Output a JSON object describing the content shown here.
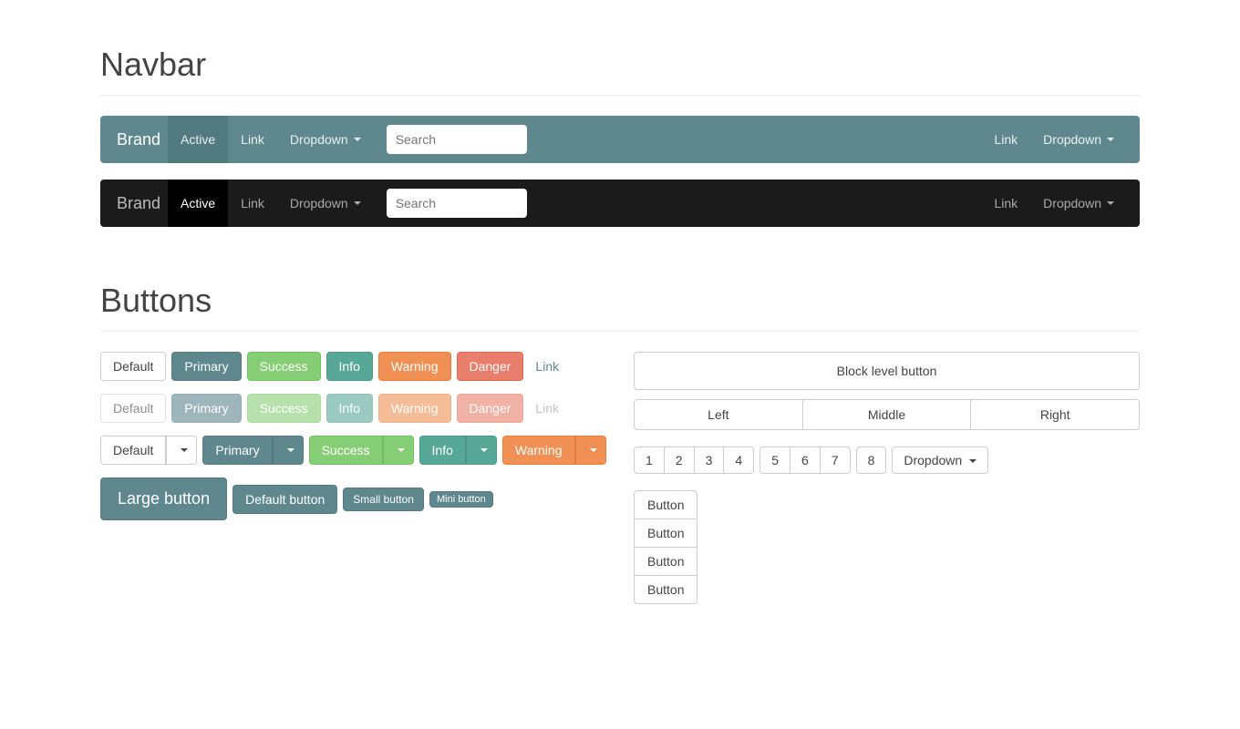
{
  "sections": {
    "navbar_heading": "Navbar",
    "buttons_heading": "Buttons"
  },
  "navbar": {
    "brand": "Brand",
    "items": [
      "Active",
      "Link",
      "Dropdown"
    ],
    "search_placeholder": "Search",
    "right_items": [
      "Link",
      "Dropdown"
    ]
  },
  "buttons": {
    "styles": [
      "Default",
      "Primary",
      "Success",
      "Info",
      "Warning",
      "Danger",
      "Link"
    ],
    "split": [
      "Default",
      "Primary",
      "Success",
      "Info",
      "Warning"
    ],
    "sizes": {
      "large": "Large button",
      "default": "Default button",
      "small": "Small button",
      "mini": "Mini button"
    },
    "block": "Block level button",
    "justified": [
      "Left",
      "Middle",
      "Right"
    ],
    "toolbar_groups": [
      [
        "1",
        "2",
        "3",
        "4"
      ],
      [
        "5",
        "6",
        "7"
      ],
      [
        "8"
      ]
    ],
    "toolbar_dropdown": "Dropdown",
    "vertical": [
      "Button",
      "Button",
      "Button",
      "Button"
    ]
  }
}
